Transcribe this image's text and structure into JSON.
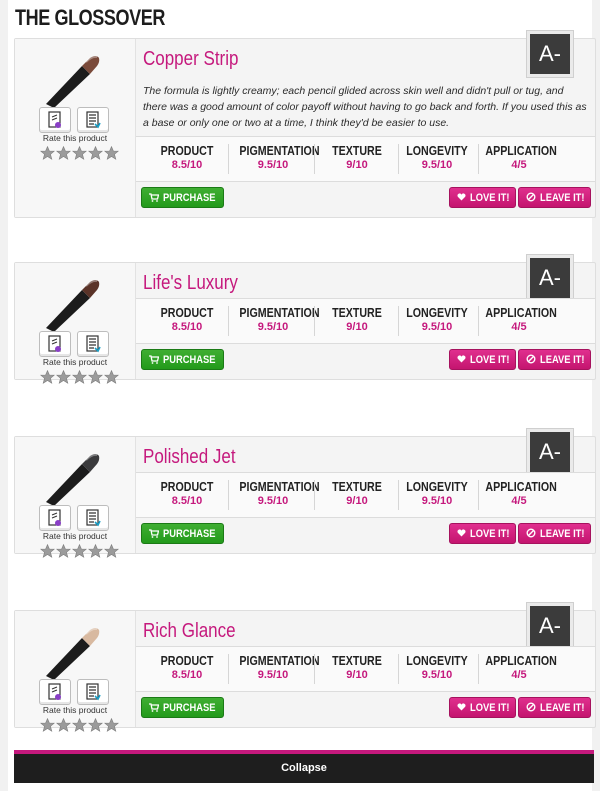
{
  "page": {
    "title": "THE GLOSSOVER"
  },
  "rate_label": "Rate this product",
  "buttons": {
    "purchase": "PURCHASE",
    "love": "LOVE IT!",
    "leave": "LEAVE IT!"
  },
  "stat_labels": [
    "PRODUCT",
    "PIGMENTATION",
    "TEXTURE",
    "LONGEVITY",
    "APPLICATION"
  ],
  "products": [
    {
      "name": "Copper Strip",
      "grade": "A-",
      "description": "The formula is lightly creamy; each pencil glided across skin well and didn't pull or tug, and there was a good amount of color payoff without having to go back and forth. If you used this as a base or only one or two at a time, I think they'd be easier to use.",
      "tip_color": "#7a4a3a",
      "ratings": [
        "8.5/10",
        "9.5/10",
        "9/10",
        "9.5/10",
        "4/5"
      ]
    },
    {
      "name": "Life's Luxury",
      "grade": "A-",
      "description": "",
      "tip_color": "#5a3328",
      "ratings": [
        "8.5/10",
        "9.5/10",
        "9/10",
        "9.5/10",
        "4/5"
      ]
    },
    {
      "name": "Polished Jet",
      "grade": "A-",
      "description": "",
      "tip_color": "#3a3a3c",
      "ratings": [
        "8.5/10",
        "9.5/10",
        "9/10",
        "9.5/10",
        "4/5"
      ]
    },
    {
      "name": "Rich Glance",
      "grade": "A-",
      "description": "",
      "tip_color": "#d8b9a0",
      "ratings": [
        "8.5/10",
        "9.5/10",
        "9/10",
        "9.5/10",
        "4/5"
      ]
    }
  ],
  "collapse_label": "Collapse",
  "colors": {
    "accent": "#c5197d",
    "purchase": "#2aa320",
    "grade_bg": "#3b3b3b"
  }
}
